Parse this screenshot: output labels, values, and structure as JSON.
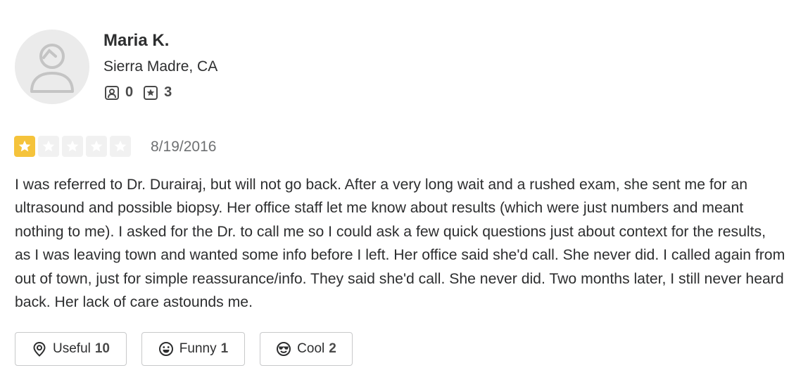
{
  "user": {
    "name": "Maria K.",
    "location": "Sierra Madre, CA",
    "friends_count": "0",
    "reviews_count": "3"
  },
  "review": {
    "rating": 1,
    "rating_max": 5,
    "date": "8/19/2016",
    "text": "I was referred to Dr. Durairaj, but will not go back. After a very long wait and a rushed exam, she sent me for an ultrasound and possible biopsy. Her office staff let me know about results (which were just numbers and meant nothing to me). I asked for the Dr. to call me so I could ask a few quick questions just about context for the results, as I was leaving town and wanted some info before I left. Her office said she'd call. She never did. I called again from out of town, just for simple reassurance/info. They said she'd call. She never did. Two months later, I still never heard back. Her lack of care astounds me."
  },
  "votes": {
    "useful_label": "Useful",
    "useful_count": "10",
    "funny_label": "Funny",
    "funny_count": "1",
    "cool_label": "Cool",
    "cool_count": "2"
  },
  "colors": {
    "star_active": "#f5c33b",
    "star_inactive": "#f1f1f1",
    "text": "#2d2e2f"
  },
  "icons": [
    "avatar-placeholder-icon",
    "friends-icon",
    "reviews-star-icon",
    "star-icon",
    "useful-icon",
    "funny-icon",
    "cool-icon"
  ]
}
